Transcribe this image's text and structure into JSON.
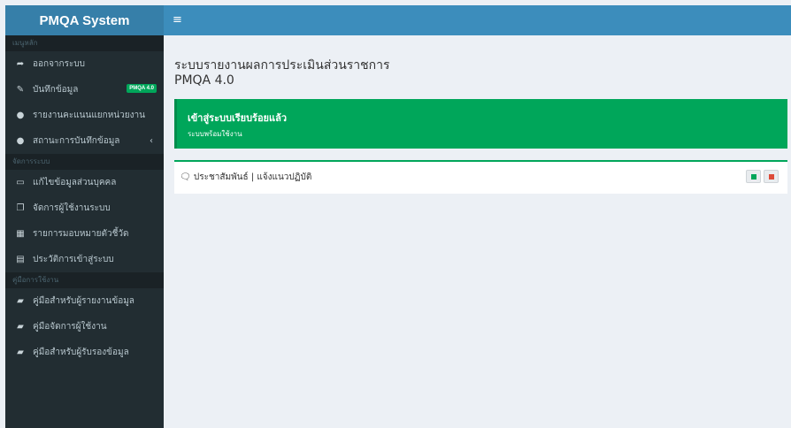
{
  "brand": {
    "title": "PMQA System"
  },
  "topbar": {
    "toggle_icon": "hamburger-icon",
    "toggle_glyph": "≡"
  },
  "sidebar": {
    "sections": [
      {
        "header": "เมนูหลัก",
        "items": [
          {
            "label": "ออกจากระบบ",
            "icon": "sign-out-icon",
            "glyph": "➦"
          },
          {
            "label": "บันทึกข้อมูล",
            "icon": "edit-icon",
            "glyph": "✎",
            "badge": "PMQA 4.0"
          },
          {
            "label": "รายงานคะแนนแยกหน่วยงาน",
            "icon": "globe-icon",
            "glyph": "●"
          },
          {
            "label": "สถานะการบันทึกข้อมูล",
            "icon": "globe-icon",
            "glyph": "●",
            "chevron": "‹"
          }
        ]
      },
      {
        "header": "จัดการระบบ",
        "items": [
          {
            "label": "แก้ไขข้อมูลส่วนบุคคล",
            "icon": "laptop-icon",
            "glyph": "▭"
          },
          {
            "label": "จัดการผู้ใช้งานระบบ",
            "icon": "copy-icon",
            "glyph": "❐"
          },
          {
            "label": "รายการมอบหมายตัวชี้วัด",
            "icon": "table-icon",
            "glyph": "▦"
          },
          {
            "label": "ประวัติการเข้าสู่ระบบ",
            "icon": "calendar-icon",
            "glyph": "▤"
          }
        ]
      },
      {
        "header": "คู่มือการใช้งาน",
        "items": [
          {
            "label": "คู่มือสำหรับผู้รายงานข้อมูล",
            "icon": "book-icon",
            "glyph": "▰"
          },
          {
            "label": "คู่มือจัดการผู้ใช้งาน",
            "icon": "book-icon",
            "glyph": "▰"
          },
          {
            "label": "คู่มือสำหรับผู้รับรองข้อมูล",
            "icon": "book-icon",
            "glyph": "▰"
          }
        ]
      }
    ]
  },
  "main": {
    "title": "ระบบรายงานผลการประเมินส่วนราชการ",
    "subtitle": "PMQA 4.0",
    "alert": {
      "heading": "เข้าสู่ระบบเรียบร้อยแล้ว",
      "text": "ระบบพร้อมใช้งาน"
    },
    "box": {
      "icon": "comments-icon",
      "glyph": "🗨",
      "label": "ประชาสัมพันธ์ | แจ้งแนวปฏิบัติ"
    }
  },
  "colors": {
    "header": "#3c8dbc",
    "logo_bg": "#367fa9",
    "sidebar_bg": "#222d32",
    "success": "#00a65a",
    "danger": "#dd4b39",
    "content_bg": "#ecf0f5"
  }
}
